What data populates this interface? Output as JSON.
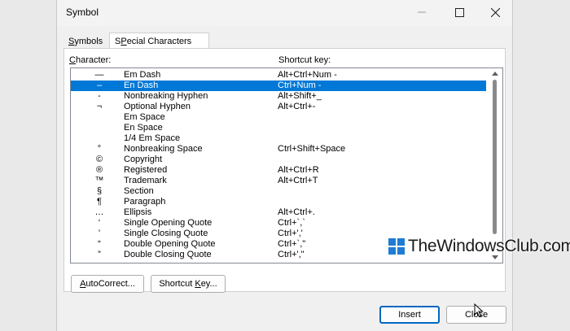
{
  "window": {
    "title": "Symbol"
  },
  "tabs": [
    {
      "label": "Symbols",
      "accel": "S",
      "rest": "ymbols",
      "active": false
    },
    {
      "label": "Special Characters",
      "accel": "P",
      "pre": "S",
      "rest": "ecial Characters",
      "active": true
    }
  ],
  "columns": {
    "character_pre": "",
    "character_accel": "C",
    "character_rest": "haracter:",
    "shortcut_key": "Shortcut key:"
  },
  "rows": [
    {
      "symbol": "—",
      "name": "Em Dash",
      "shortcut": "Alt+Ctrl+Num -"
    },
    {
      "symbol": "–",
      "name": "En Dash",
      "shortcut": "Ctrl+Num -",
      "selected": true
    },
    {
      "symbol": "-",
      "name": "Nonbreaking Hyphen",
      "shortcut": "Alt+Shift+_"
    },
    {
      "symbol": "¬",
      "name": "Optional Hyphen",
      "shortcut": "Alt+Ctrl+-"
    },
    {
      "symbol": "",
      "name": "Em Space",
      "shortcut": ""
    },
    {
      "symbol": "",
      "name": "En Space",
      "shortcut": ""
    },
    {
      "symbol": "",
      "name": "1/4 Em Space",
      "shortcut": ""
    },
    {
      "symbol": "°",
      "name": "Nonbreaking Space",
      "shortcut": "Ctrl+Shift+Space"
    },
    {
      "symbol": "©",
      "name": "Copyright",
      "shortcut": ""
    },
    {
      "symbol": "®",
      "name": "Registered",
      "shortcut": "Alt+Ctrl+R"
    },
    {
      "symbol": "™",
      "name": "Trademark",
      "shortcut": "Alt+Ctrl+T"
    },
    {
      "symbol": "§",
      "name": "Section",
      "shortcut": ""
    },
    {
      "symbol": "¶",
      "name": "Paragraph",
      "shortcut": ""
    },
    {
      "symbol": "…",
      "name": "Ellipsis",
      "shortcut": "Alt+Ctrl+."
    },
    {
      "symbol": "‘",
      "name": "Single Opening Quote",
      "shortcut": "Ctrl+`,`"
    },
    {
      "symbol": "’",
      "name": "Single Closing Quote",
      "shortcut": "Ctrl+','"
    },
    {
      "symbol": "“",
      "name": "Double Opening Quote",
      "shortcut": "Ctrl+`,\""
    },
    {
      "symbol": "”",
      "name": "Double Closing Quote",
      "shortcut": "Ctrl+',\""
    }
  ],
  "buttons": {
    "autocorrect_accel": "A",
    "autocorrect_rest": "utoCorrect...",
    "shortcut_pre": "Shortcut ",
    "shortcut_accel": "K",
    "shortcut_rest": "ey...",
    "insert": "Insert",
    "close": "Close"
  },
  "watermark": {
    "text": "TheWindowsClub.com"
  },
  "icons": {
    "minimize": "minimize-icon",
    "maximize": "maximize-icon",
    "close": "close-icon",
    "logo": "windows-logo-icon",
    "cursor": "mouse-pointer-icon"
  },
  "colors": {
    "selection": "#0078d7",
    "default_button_border": "#0067c0",
    "watermark_logo": "#1f7bd4"
  }
}
